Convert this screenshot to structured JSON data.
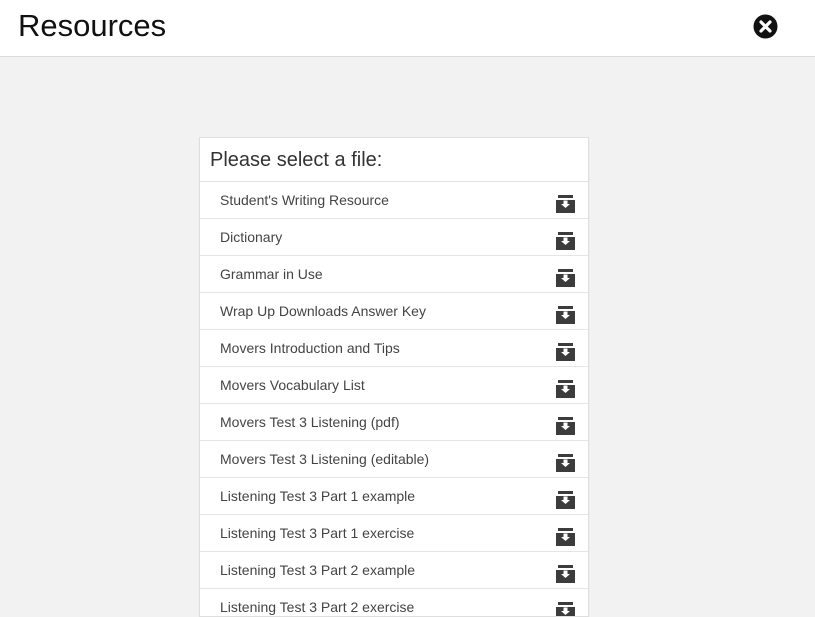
{
  "header": {
    "title": "Resources",
    "close_icon": "close-circle-icon"
  },
  "panel": {
    "title": "Please select a file:",
    "files": [
      {
        "label": "Student's Writing Resource",
        "icon": "download-icon"
      },
      {
        "label": "Dictionary",
        "icon": "download-icon"
      },
      {
        "label": "Grammar in Use",
        "icon": "download-icon"
      },
      {
        "label": "Wrap Up Downloads Answer Key",
        "icon": "download-icon"
      },
      {
        "label": "Movers Introduction and Tips",
        "icon": "download-icon"
      },
      {
        "label": "Movers Vocabulary List",
        "icon": "download-icon"
      },
      {
        "label": "Movers Test 3 Listening (pdf)",
        "icon": "download-icon"
      },
      {
        "label": "Movers Test 3 Listening (editable)",
        "icon": "download-icon"
      },
      {
        "label": "Listening Test 3 Part 1 example",
        "icon": "download-icon"
      },
      {
        "label": "Listening Test 3 Part 1 exercise",
        "icon": "download-icon"
      },
      {
        "label": "Listening Test 3 Part 2 example",
        "icon": "download-icon"
      },
      {
        "label": "Listening Test 3 Part 2 exercise",
        "icon": "download-icon"
      }
    ]
  },
  "colors": {
    "background": "#f2f2f2",
    "icon": "#3c3c3c"
  }
}
